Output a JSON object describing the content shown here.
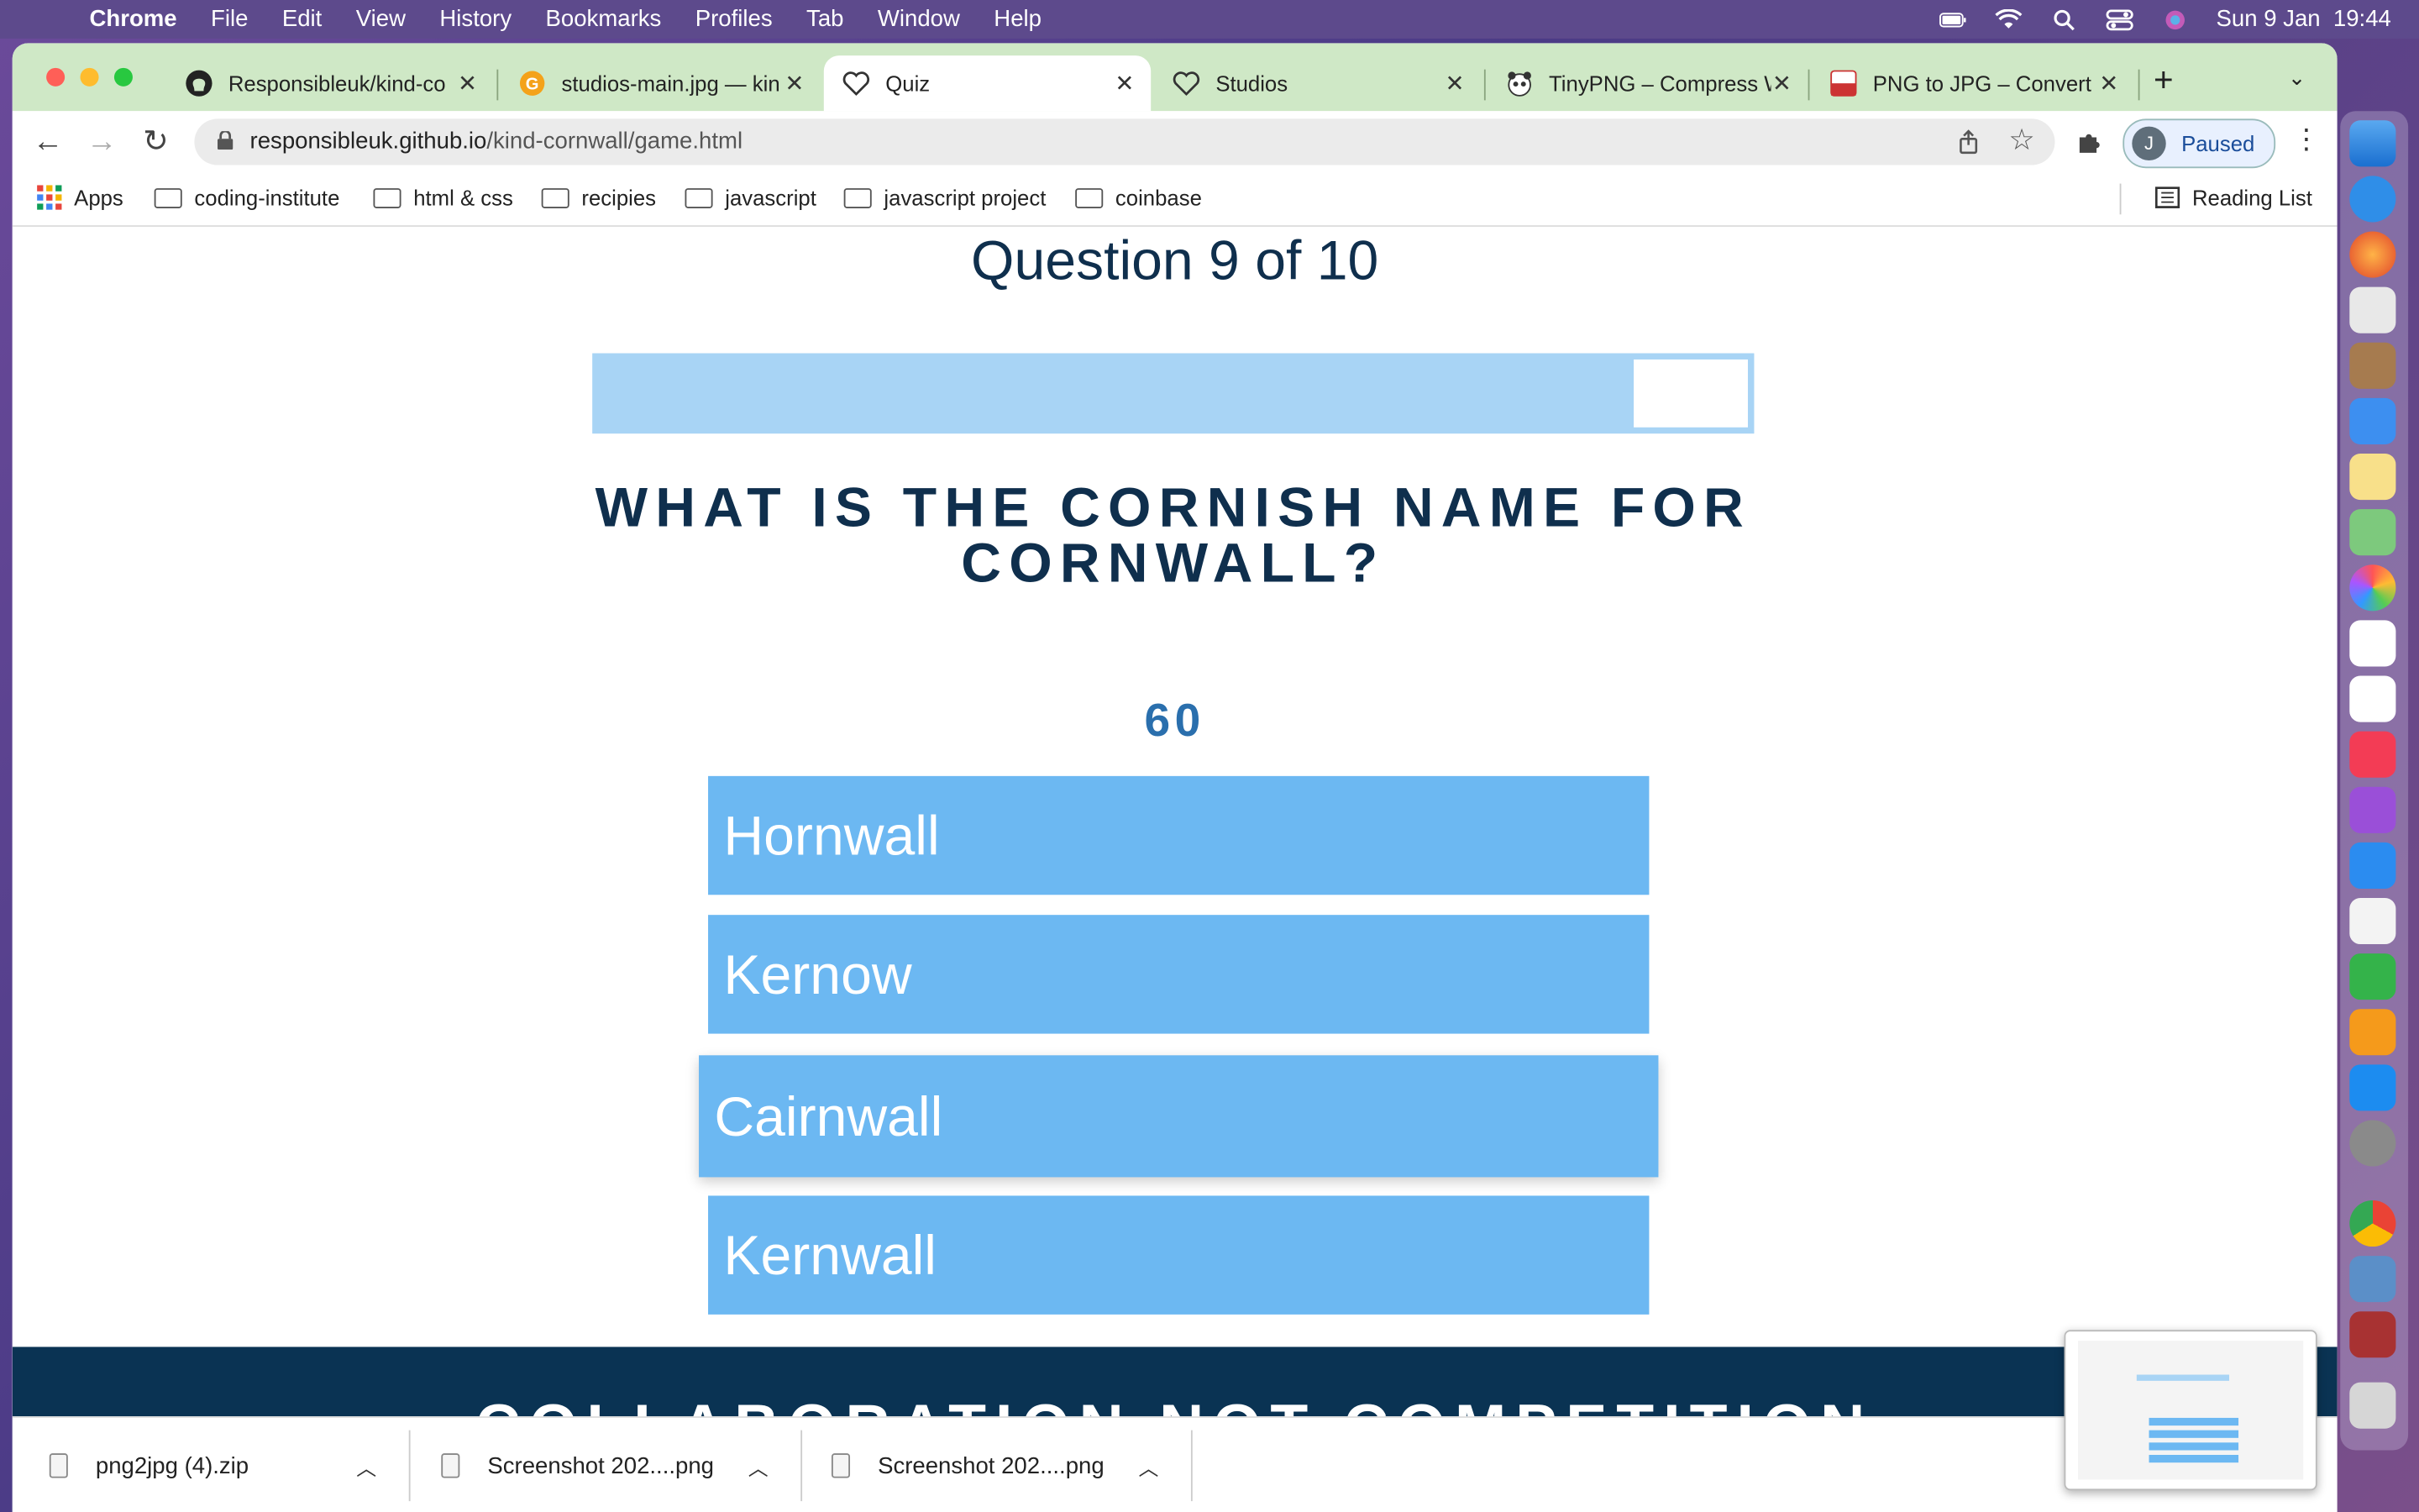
{
  "menubar": {
    "app": "Chrome",
    "items": [
      "File",
      "Edit",
      "View",
      "History",
      "Bookmarks",
      "Profiles",
      "Tab",
      "Window",
      "Help"
    ],
    "datetime": "Sun 9 Jan  19:44"
  },
  "tabs": [
    {
      "title": "Responsibleuk/kind-co",
      "icon": "github-icon"
    },
    {
      "title": "studios-main.jpg — kin",
      "icon": "g-icon"
    },
    {
      "title": "Quiz",
      "icon": "heart-icon",
      "active": true
    },
    {
      "title": "Studios",
      "icon": "heart-icon"
    },
    {
      "title": "TinyPNG – Compress W",
      "icon": "panda-icon"
    },
    {
      "title": "PNG to JPG – Convert",
      "icon": "png-jpg-icon"
    }
  ],
  "address": {
    "host": "responsibleuk.github.io",
    "path": "/kind-cornwall/game.html"
  },
  "profile": {
    "initial": "J",
    "label": "Paused"
  },
  "bookmarks": {
    "apps": "Apps",
    "items": [
      "coding-institute",
      "html & css",
      "recipies",
      "javascript",
      "javascript project",
      "coinbase"
    ],
    "reading_list": "Reading List"
  },
  "quiz": {
    "counter": "Question 9 of 10",
    "progress": 0.9,
    "question": "WHAT IS THE CORNISH NAME FOR CORNWALL?",
    "timer": "60",
    "answers": [
      "Hornwall",
      "Kernow",
      "Cairnwall",
      "Kernwall"
    ],
    "hovered_answer": "Cairnwall"
  },
  "footer": {
    "text": "COLLABORATION NOT COMPETITION"
  },
  "downloads": [
    "png2jpg (4).zip",
    "Screenshot 202....png",
    "Screenshot 202....png"
  ],
  "colors": {
    "answer_bg": "#6cb8f2",
    "progress_bg": "#a8d4f5",
    "heading": "#0f2f4d",
    "timer": "#2a6fad",
    "footer_bg": "#0a3353"
  }
}
